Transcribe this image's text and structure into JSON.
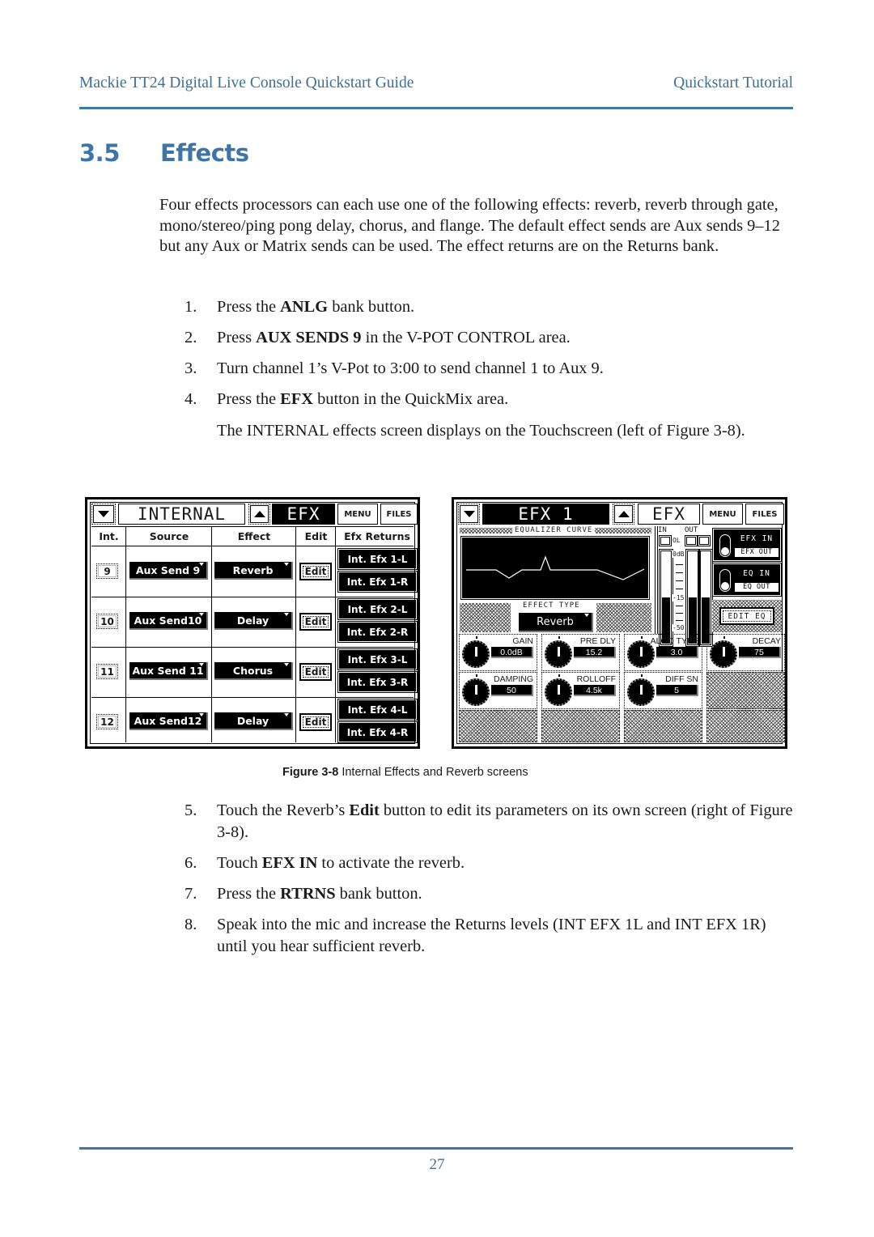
{
  "header": {
    "title": "Mackie TT24 Digital  Live Console Quickstart Guide",
    "chapter": "Quickstart Tutorial"
  },
  "section": {
    "number": "3.5",
    "title": "Effects"
  },
  "intro": "Four effects processors can each use one of the following effects: reverb, reverb through gate, mono/stereo/ping pong delay, chorus, and flange. The default effect sends are Aux sends 9–12 but any Aux or Matrix sends can be used. The effect returns are on the Returns bank.",
  "steps_a": [
    {
      "n": "1.",
      "pre": "Press the ",
      "bold": "ANLG",
      "post": " bank button."
    },
    {
      "n": "2.",
      "pre": "Press ",
      "bold": "AUX SENDS 9",
      "post": " in the V-POT CONTROL area."
    },
    {
      "n": "3.",
      "pre": "Turn channel 1’s V-Pot to 3:00 to send channel 1 to Aux 9.",
      "bold": "",
      "post": ""
    },
    {
      "n": "4.",
      "pre": "Press the ",
      "bold": "EFX",
      "post": " button in the QuickMix area."
    }
  ],
  "step4_note": "The INTERNAL effects screen displays on the Touchscreen (left of Figure 3-8).",
  "figure": {
    "label": "Figure 3-8",
    "caption": " Internal Effects and Reverb screens",
    "internal_screen": {
      "title": "INTERNAL",
      "mode": "EFX",
      "menu": "MENU",
      "files": "FILES",
      "columns": [
        "Int.",
        "Source",
        "Effect",
        "Edit",
        "Efx Returns"
      ],
      "rows": [
        {
          "int": "9",
          "source": "Aux Send 9",
          "effect": "Reverb",
          "edit": "Edit",
          "ret_l": "Int. Efx 1-L",
          "ret_r": "Int. Efx 1-R"
        },
        {
          "int": "10",
          "source": "Aux Send10",
          "effect": "Delay",
          "edit": "Edit",
          "ret_l": "Int. Efx 2-L",
          "ret_r": "Int. Efx 2-R"
        },
        {
          "int": "11",
          "source": "Aux Send 11",
          "effect": "Chorus",
          "edit": "Edit",
          "ret_l": "Int. Efx 3-L",
          "ret_r": "Int. Efx 3-R"
        },
        {
          "int": "12",
          "source": "Aux Send12",
          "effect": "Delay",
          "edit": "Edit",
          "ret_l": "Int. Efx 4-L",
          "ret_r": "Int. Efx 4-R"
        }
      ]
    },
    "efx_screen": {
      "title": "EFX 1",
      "mode": "EFX",
      "menu": "MENU",
      "files": "FILES",
      "eq_label": "EQUALIZER CURVE",
      "effect_type_label": "EFFECT TYPE",
      "effect_type": "Reverb",
      "meter_in": "IN",
      "meter_out": "OUT",
      "meter_ol": "OL",
      "meter_scale": [
        "0dB",
        "-15",
        "-50"
      ],
      "meter_levels": {
        "in": 0.5,
        "out_l": 0.5,
        "out_r": 0.5
      },
      "efx_in": "EFX IN",
      "efx_out": "EFX OUT",
      "eq_in": "EQ IN",
      "eq_out": "EQ OUT",
      "edit_eq": "EDIT EQ",
      "params": [
        {
          "label": "GAIN",
          "value": "0.0dB"
        },
        {
          "label": "PRE DLY",
          "value": "15.2"
        },
        {
          "label": "ALGO TYPE",
          "value": "3.0"
        },
        {
          "label": "DECAY",
          "value": "75"
        },
        {
          "label": "DAMPING",
          "value": "50"
        },
        {
          "label": "ROLLOFF",
          "value": "4.5k"
        },
        {
          "label": "DIFF SN",
          "value": "5"
        }
      ]
    }
  },
  "steps_b": [
    {
      "n": "5.",
      "pre": "Touch the Reverb’s ",
      "bold": "Edit",
      "post": " button to edit its parameters on its own screen (right of Figure 3-8)."
    },
    {
      "n": "6.",
      "pre": "Touch ",
      "bold": "EFX IN",
      "post": " to activate the reverb."
    },
    {
      "n": "7.",
      "pre": "Press the ",
      "bold": "RTRNS",
      "post": " bank button."
    },
    {
      "n": "8.",
      "pre": "Speak into the mic and increase the Returns levels (INT EFX 1L and INT EFX 1R) until you hear sufficient reverb.",
      "bold": "",
      "post": ""
    }
  ],
  "footer": {
    "page": "27"
  },
  "colors": {
    "accent": "#3c79a8",
    "header_text": "#3e6f94"
  }
}
